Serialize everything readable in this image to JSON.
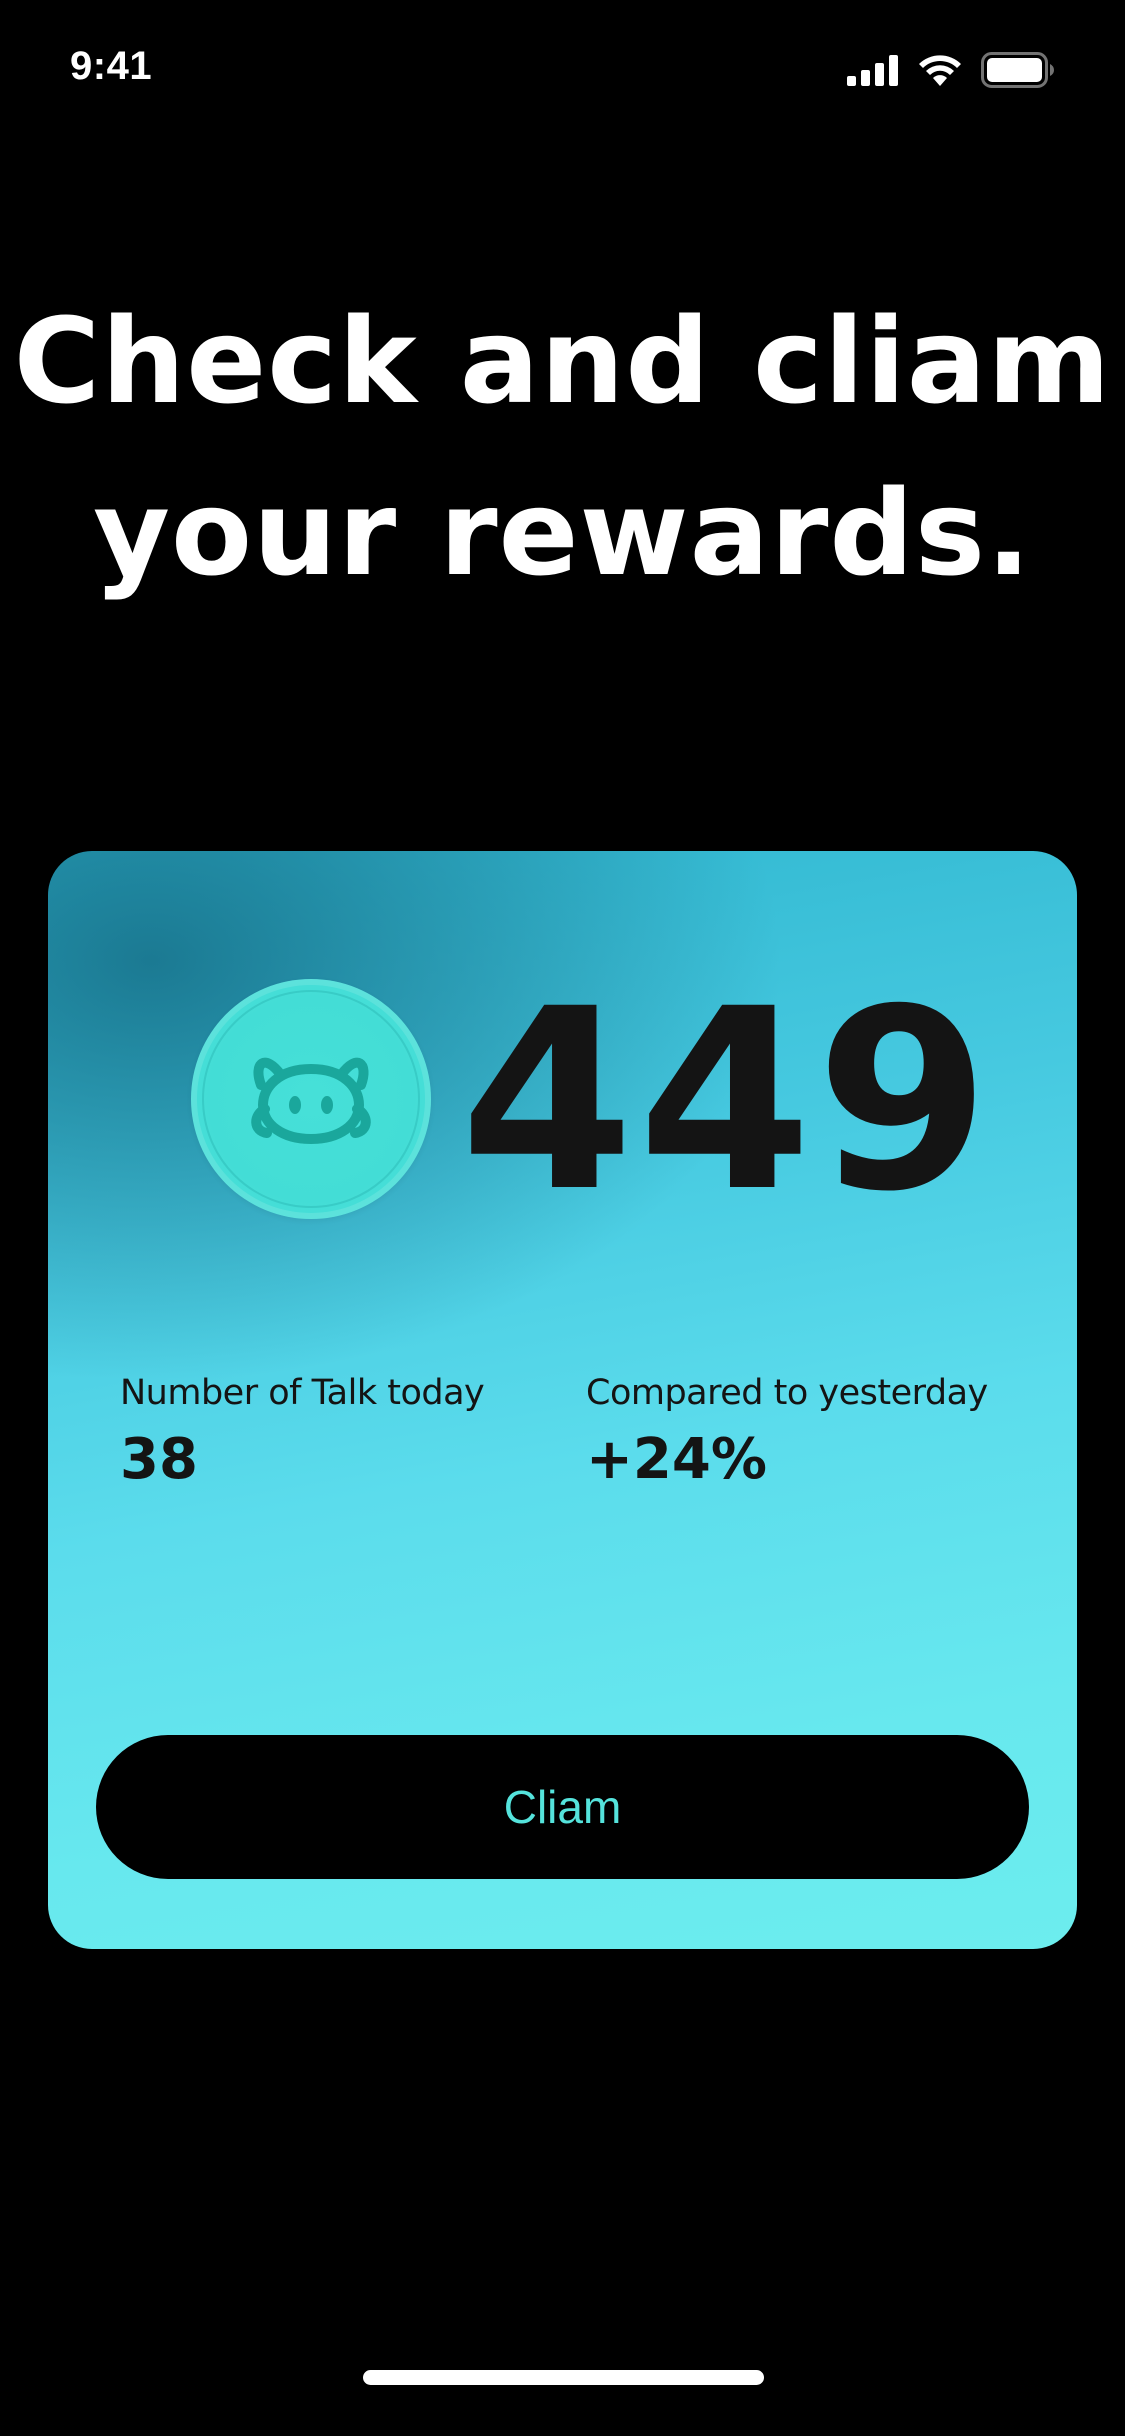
{
  "status_bar": {
    "time": "9:41",
    "icons": [
      "cellular-signal-icon",
      "wifi-icon",
      "battery-icon"
    ]
  },
  "headline": {
    "line1": "Check and cliam",
    "line2": "your rewards."
  },
  "reward_card": {
    "coin_icon": "creature-face-icon",
    "points": "449",
    "stats": [
      {
        "label": "Number of Talk today",
        "value": "38"
      },
      {
        "label": "Compared to yesterday",
        "value": "+24%"
      }
    ],
    "claim_label": "Cliam"
  },
  "colors": {
    "background": "#000000",
    "card_dark": "#166e87",
    "card_light": "#6cedee",
    "coin": "#46e0d8",
    "accent_text": "#55e3dc",
    "text_dark": "#141414"
  }
}
